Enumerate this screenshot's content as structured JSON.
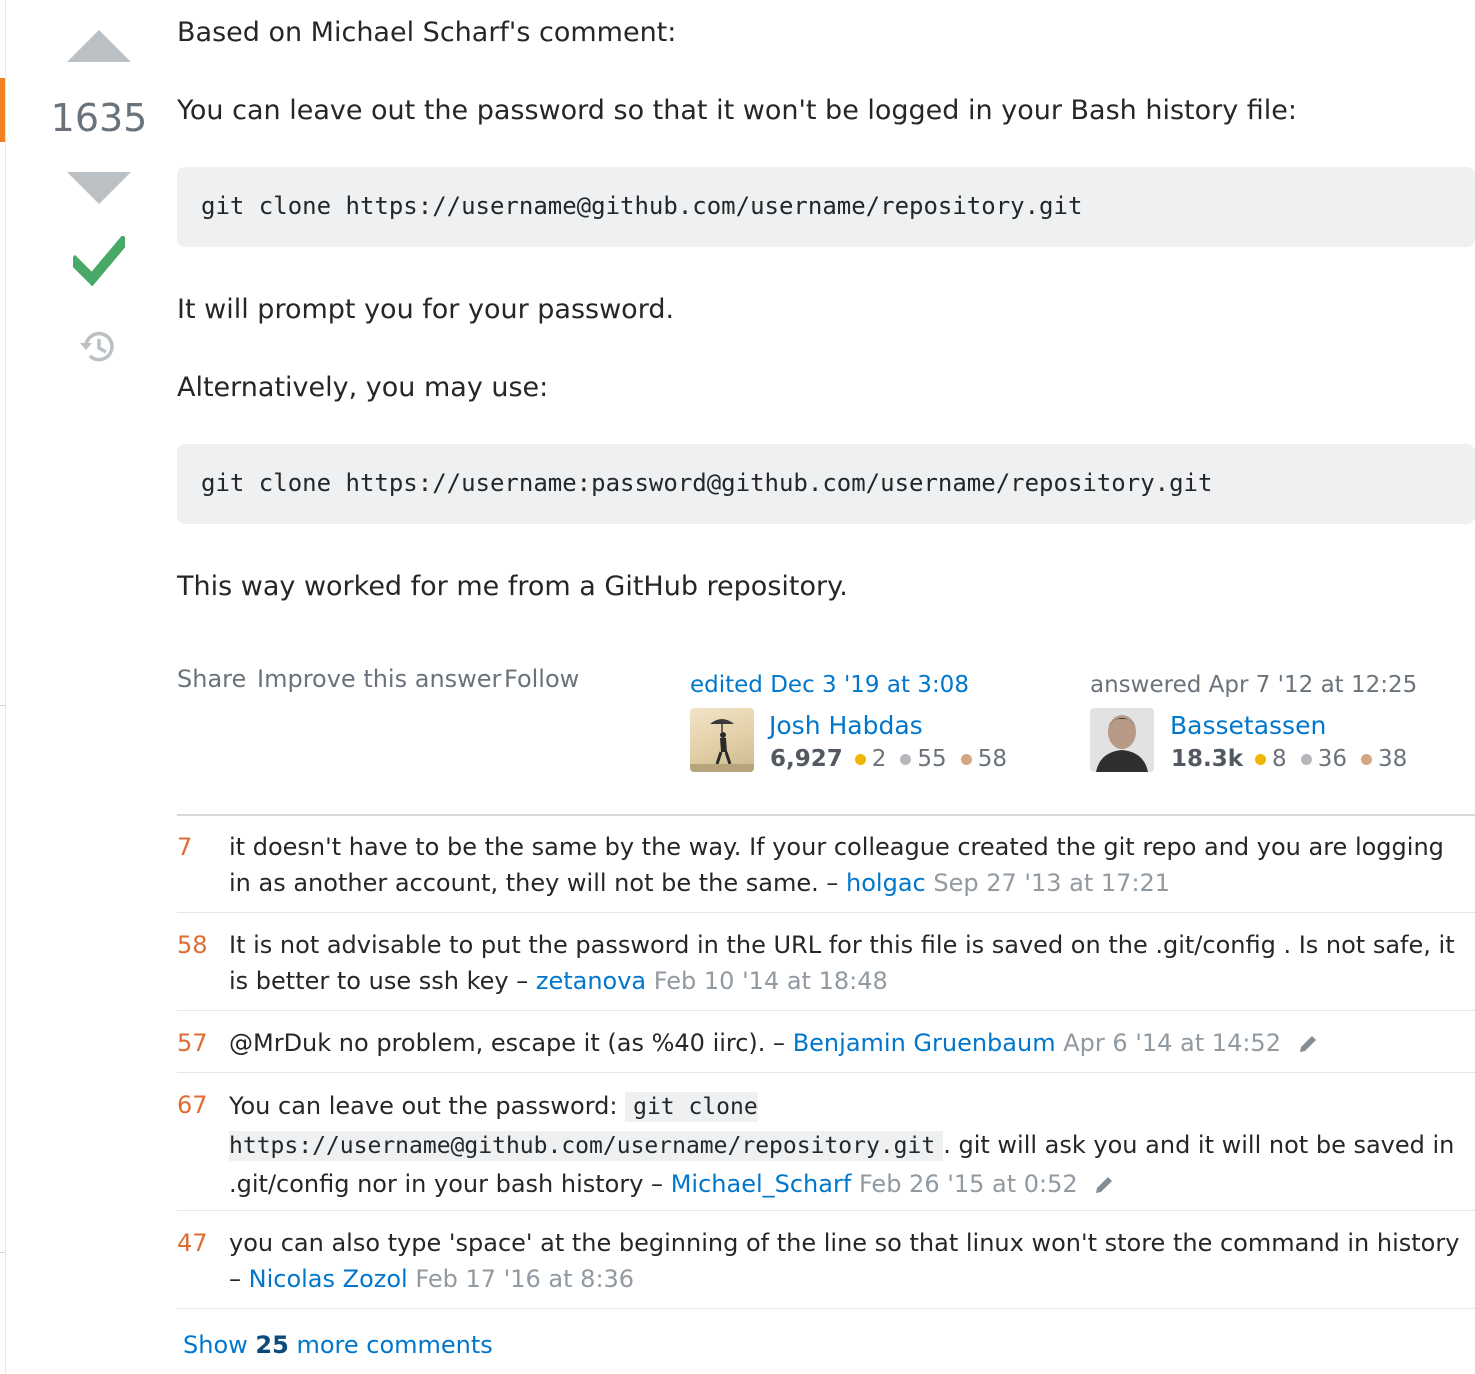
{
  "vote": {
    "count": "1635"
  },
  "post": {
    "paragraphs": [
      "Based on Michael Scharf's comment:",
      "You can leave out the password so that it won't be logged in your Bash history file:",
      "It will prompt you for your password.",
      "Alternatively, you may use:",
      "This way worked for me from a GitHub repository."
    ],
    "code": [
      "git clone https://username@github.com/username/repository.git",
      "git clone https://username:password@github.com/username/repository.git"
    ]
  },
  "menu": {
    "share": "Share",
    "improve": "Improve this answer",
    "follow": "Follow"
  },
  "editor": {
    "action": "edited Dec 3 '19 at 3:08",
    "name": "Josh Habdas",
    "rep": "6,927",
    "gold": "2",
    "silver": "55",
    "bronze": "58"
  },
  "author": {
    "action": "answered Apr 7 '12 at 12:25",
    "name": "Bassetassen",
    "rep": "18.3k",
    "gold": "8",
    "silver": "36",
    "bronze": "38"
  },
  "colors": {
    "gold": "#f1b600",
    "silver": "#9fa6ad",
    "bronze": "#d1a684",
    "accent": "#f48024",
    "link": "#0077cc",
    "check": "#48a868"
  },
  "comments": [
    {
      "score": "7",
      "text": "it doesn't have to be the same by the way. If your colleague created the git repo and you are logging in as another account, they will not be the same. –",
      "user": "holgac",
      "date": "Sep 27 '13 at 17:21"
    },
    {
      "score": "58",
      "text": "It is not advisable to put the password in the URL for this file is saved on the .git/config . Is not safe, it is better to use ssh key –",
      "user": "zetanova",
      "date": "Feb 10 '14 at 18:48"
    },
    {
      "score": "57",
      "text": "@MrDuk no problem, escape it (as %40 iirc). –",
      "user": "Benjamin Gruenbaum",
      "date": "Apr 6 '14 at 14:52"
    },
    {
      "score": "67",
      "text_before": "You can leave out the password:",
      "code": "git clone https://username@github.com/username/repository.git",
      "text_after": ". git will ask you and it will not be saved in .git/config nor in your bash history –",
      "user": "Michael_Scharf",
      "date": "Feb 26 '15 at 0:52"
    },
    {
      "score": "47",
      "text": "you can also type 'space' at the beginning of the line so that linux won't store the command in history –",
      "user": "Nicolas Zozol",
      "date": "Feb 17 '16 at 8:36"
    }
  ],
  "show_more": {
    "prefix": "Show",
    "count": "25",
    "suffix": "more comments"
  }
}
